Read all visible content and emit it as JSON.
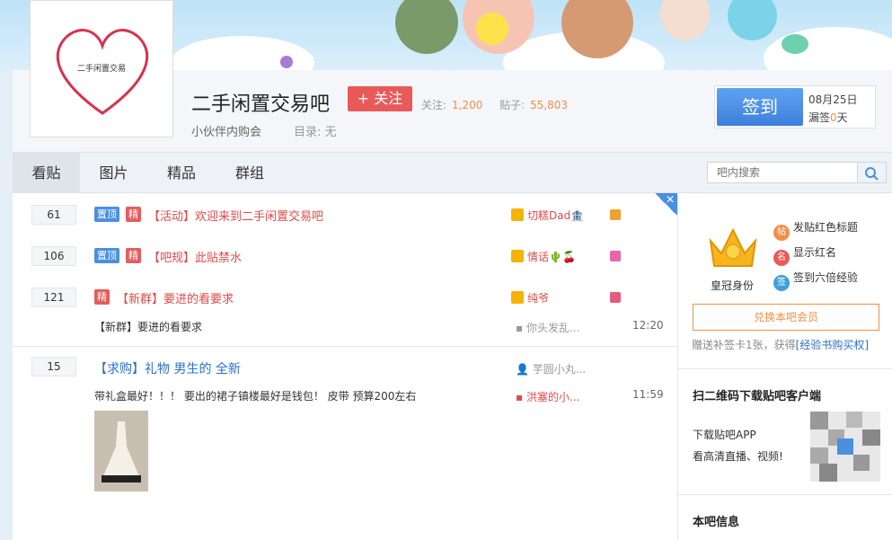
{
  "forum": {
    "name": "二手闲置交易吧",
    "logo_text": "二手闲置交易",
    "follow_label": "+ 关注",
    "follow_count_label": "关注:",
    "follow_count": "1,200",
    "post_count_label": "贴子:",
    "post_count": "55,803",
    "slogan": "小伙伴内购会",
    "catalog_label": "目录:",
    "catalog_value": "无"
  },
  "sign": {
    "button": "签到",
    "date": "08月25日",
    "missed_prefix": "漏签",
    "missed_count": "0",
    "missed_suffix": "天"
  },
  "tabs": [
    "看贴",
    "图片",
    "精品",
    "群组"
  ],
  "search": {
    "placeholder": "吧内搜索"
  },
  "threads": [
    {
      "count": "61",
      "tags": [
        "置顶",
        "精"
      ],
      "title": "【活动】欢迎来到二手闲置交易吧",
      "author": "切糕Dad🏦",
      "icon_color": "#f0a030"
    },
    {
      "count": "106",
      "tags": [
        "置顶",
        "精"
      ],
      "title": "【吧规】此贴禁水",
      "author": "情话🌵🍒",
      "icon_color": "#e865a8"
    },
    {
      "count": "121",
      "tags": [
        "精"
      ],
      "title": "【新群】要进的看要求",
      "author": "纯爷",
      "icon_color": "#e85a7a",
      "desc": "【新群】要进的看要求",
      "reply": "你头发乱...",
      "time": "12:20"
    },
    {
      "count": "15",
      "tags": [],
      "title": "【求购】礼物 男生的 全新",
      "author": "芋圆小丸...",
      "desc": "带礼盒最好！！！ 要出的裙子镇楼最好是钱包！ 皮带 预算200左右",
      "reply": "洪塞的小...",
      "time": "11:59"
    }
  ],
  "sidebar": {
    "crown_label": "皇冠身份",
    "privileges": [
      "发贴红色标题",
      "显示红名",
      "签到六倍经验"
    ],
    "member_button": "兑换本吧会员",
    "gift_text": "赠送补签卡1张，获得",
    "gift_link": "[经验书购买权]",
    "qr_title": "扫二维码下载贴吧客户端",
    "qr_line1": "下载贴吧APP",
    "qr_line2": "看高清直播、视频!",
    "info_title": "本吧信息"
  },
  "colors": {
    "accent": "#4b8fe0",
    "red": "#e55d5d",
    "orange": "#f18f47"
  }
}
